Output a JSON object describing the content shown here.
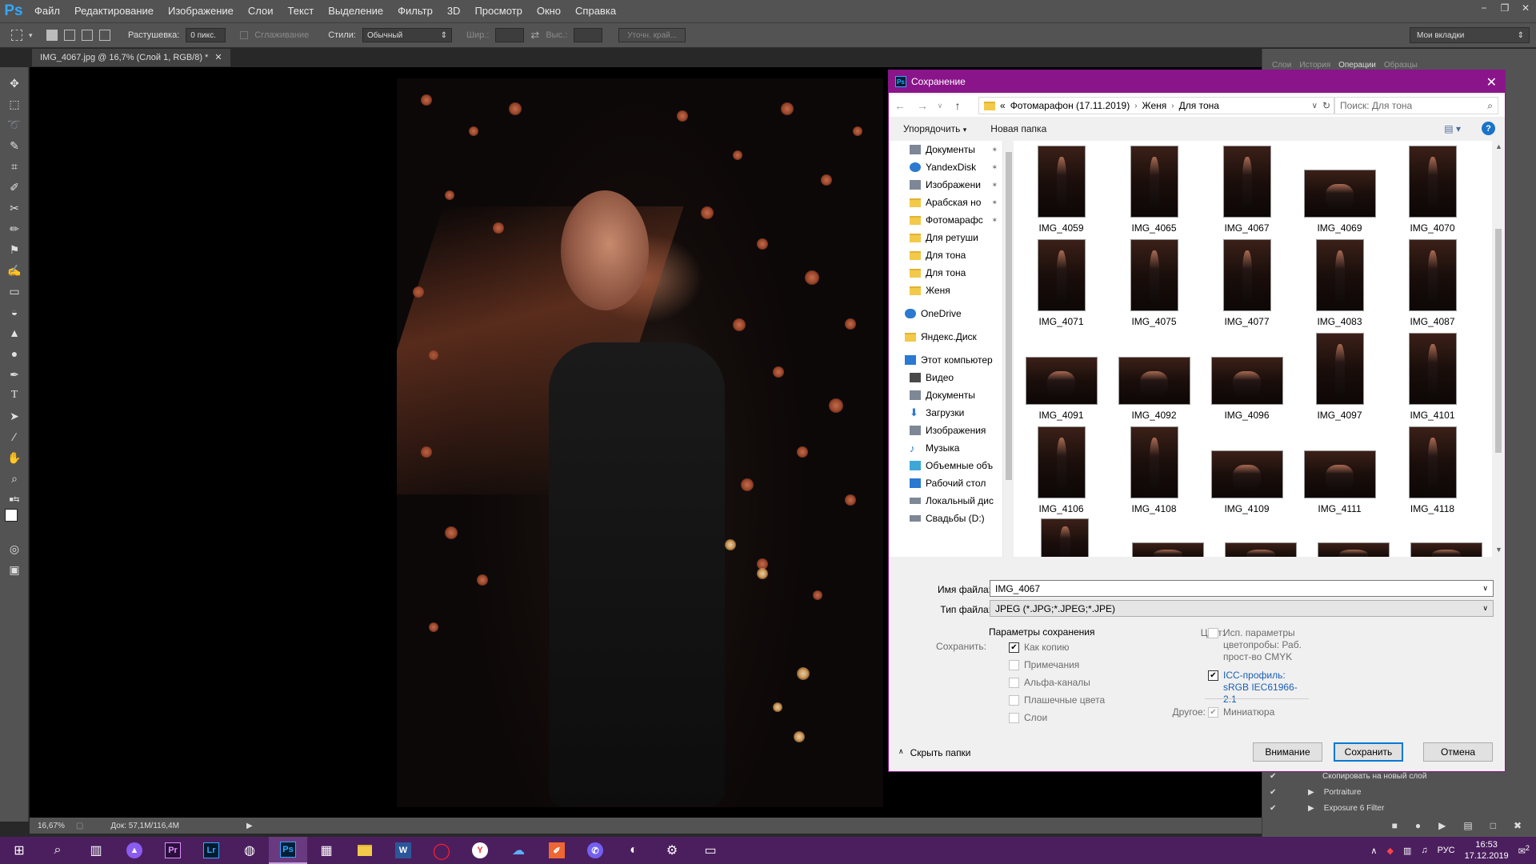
{
  "app": {
    "logo": "Ps",
    "menu": [
      "Файл",
      "Редактирование",
      "Изображение",
      "Слои",
      "Текст",
      "Выделение",
      "Фильтр",
      "3D",
      "Просмотр",
      "Окно",
      "Справка"
    ]
  },
  "options": {
    "feather_label": "Растушевка:",
    "feather_value": "0 пикс.",
    "antialias_label": "Сглаживание",
    "style_label": "Стили:",
    "style_value": "Обычный",
    "width_label": "Шир.:",
    "height_label": "Выс.:",
    "refine_label": "Уточн. край...",
    "workspace": "Мои вкладки"
  },
  "document": {
    "tab_title": "IMG_4067.jpg @ 16,7% (Слой 1, RGB/8) *",
    "zoom": "16,67%",
    "doc_info": "Док: 57,1M/116,4M"
  },
  "right_panel": {
    "tabs": [
      "Слои",
      "История",
      "Операции",
      "Образцы"
    ],
    "actions": [
      "Скопировать на новый слой",
      "Portraiture",
      "Exposure 6 Filter"
    ]
  },
  "dialog": {
    "title": "Сохранение",
    "breadcrumb": [
      "«",
      "Фотомарафон (17.11.2019)",
      "Женя",
      "Для тона"
    ],
    "search_placeholder": "Поиск: Для тона",
    "organize_label": "Упорядочить",
    "new_folder_label": "Новая папка",
    "help": "?",
    "nav_items": [
      {
        "label": "Документы",
        "icon": "documents-icon",
        "pinned": true
      },
      {
        "label": "YandexDisk",
        "icon": "yandex-disk-icon",
        "pinned": true
      },
      {
        "label": "Изображени",
        "icon": "pictures-icon",
        "pinned": true
      },
      {
        "label": "Арабская но",
        "icon": "folder-icon",
        "pinned": true
      },
      {
        "label": "Фотомарафс",
        "icon": "folder-icon",
        "pinned": true
      },
      {
        "label": "Для ретуши",
        "icon": "folder-icon",
        "pinned": false
      },
      {
        "label": "Для тона",
        "icon": "folder-icon",
        "pinned": false
      },
      {
        "label": "Для тона",
        "icon": "folder-icon",
        "pinned": false
      },
      {
        "label": "Женя",
        "icon": "folder-icon",
        "pinned": false
      },
      {
        "label": "OneDrive",
        "icon": "onedrive-icon",
        "pinned": false
      },
      {
        "label": "Яндекс.Диск",
        "icon": "folder-icon",
        "pinned": false
      },
      {
        "label": "Этот компьютер",
        "icon": "computer-icon",
        "pinned": false
      },
      {
        "label": "Видео",
        "icon": "video-icon",
        "pinned": false
      },
      {
        "label": "Документы",
        "icon": "documents-icon",
        "pinned": false
      },
      {
        "label": "Загрузки",
        "icon": "downloads-icon",
        "pinned": false
      },
      {
        "label": "Изображения",
        "icon": "pictures-icon",
        "pinned": false
      },
      {
        "label": "Музыка",
        "icon": "music-icon",
        "pinned": false
      },
      {
        "label": "Объемные объ",
        "icon": "3d-objects-icon",
        "pinned": false
      },
      {
        "label": "Рабочий стол",
        "icon": "desktop-icon",
        "pinned": false
      },
      {
        "label": "Локальный дис",
        "icon": "drive-icon",
        "pinned": false
      },
      {
        "label": "Свадьбы (D:)",
        "icon": "drive-icon",
        "pinned": false
      }
    ],
    "files": [
      "IMG_4059",
      "IMG_4065",
      "IMG_4067",
      "IMG_4069",
      "IMG_4070",
      "IMG_4071",
      "IMG_4075",
      "IMG_4077",
      "IMG_4083",
      "IMG_4087",
      "IMG_4091",
      "IMG_4092",
      "IMG_4096",
      "IMG_4097",
      "IMG_4101",
      "IMG_4106",
      "IMG_4108",
      "IMG_4109",
      "IMG_4111",
      "IMG_4118"
    ],
    "filename_label": "Имя файла:",
    "filename_value": "IMG_4067",
    "filetype_label": "Тип файла:",
    "filetype_value": "JPEG (*.JPG;*.JPEG;*.JPE)",
    "save_params_title": "Параметры сохранения",
    "save_label": "Сохранить:",
    "save_options": [
      {
        "label": "Как копию",
        "checked": true
      },
      {
        "label": "Примечания",
        "checked": false
      },
      {
        "label": "Альфа-каналы",
        "checked": false
      },
      {
        "label": "Плашечные цвета",
        "checked": false
      },
      {
        "label": "Слои",
        "checked": false
      }
    ],
    "color_label": "Цвет:",
    "color_proof": "Исп. параметры цветопробы: Раб. прост-во CMYK",
    "icc_profile": "ICC-профиль: sRGB IEC61966-2.1",
    "other_label": "Другое:",
    "thumbnail": "Миниатюра",
    "hide_folders": "Скрыть папки",
    "btn_warning": "Внимание",
    "btn_save": "Сохранить",
    "btn_cancel": "Отмена"
  },
  "taskbar": {
    "lang": "РУС",
    "time": "16:53",
    "date": "17.12.2019",
    "notification_count": "2"
  }
}
